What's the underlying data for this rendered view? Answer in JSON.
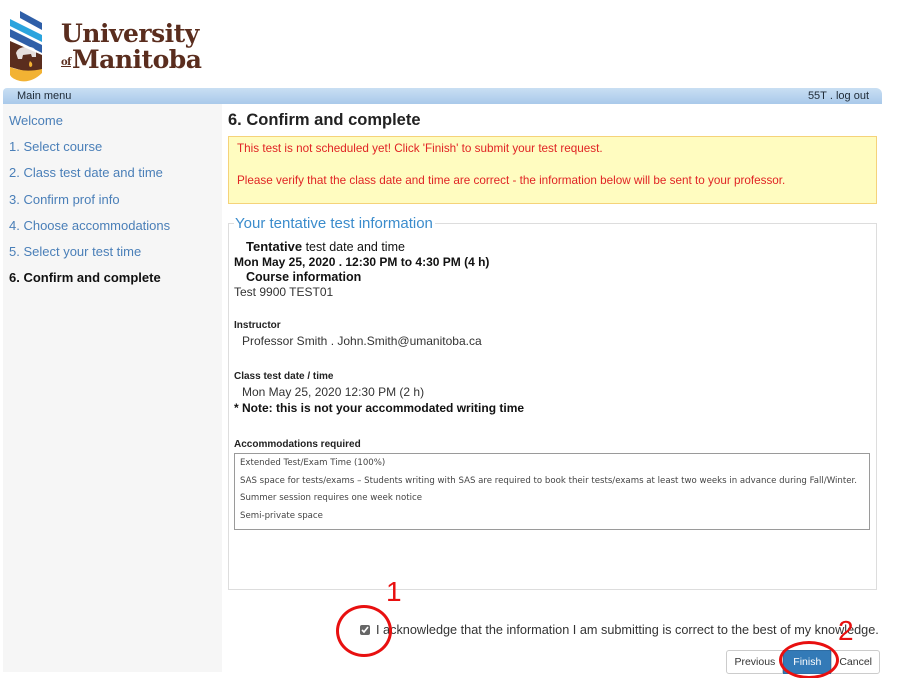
{
  "logo": {
    "line1": "University",
    "of": "of",
    "line2": "Manitoba"
  },
  "topbar": {
    "menu_label": "Main menu",
    "user_id": "55T",
    "separator": ".",
    "logout_label": "log out"
  },
  "sidebar": {
    "items": [
      {
        "label": "Welcome",
        "active": false
      },
      {
        "label": "1. Select course",
        "active": false
      },
      {
        "label": "2. Class test date and time",
        "active": false
      },
      {
        "label": "3. Confirm prof info",
        "active": false
      },
      {
        "label": "4. Choose accommodations",
        "active": false
      },
      {
        "label": "5. Select your test time",
        "active": false
      },
      {
        "label": "6. Confirm and complete",
        "active": true
      }
    ]
  },
  "main": {
    "page_title": "6. Confirm and complete",
    "alert": {
      "line1": "This test is not scheduled yet! Click 'Finish' to submit your test request.",
      "line2": "Please verify that the class date and time are correct - the information below will be sent to your professor."
    },
    "info": {
      "legend": "Your tentative test information",
      "tentative_bold": "Tentative",
      "tentative_rest": " test date and time",
      "tentative_date": "Mon May 25, 2020 . 12:30 PM to 4:30 PM (4 h)",
      "course_heading": "Course information",
      "course_value": "Test 9900 TEST01",
      "instructor_label": "Instructor",
      "instructor_value": "Professor Smith . John.Smith@umanitoba.ca",
      "class_label": "Class test date / time",
      "class_value": "Mon May 25, 2020 12:30 PM (2 h)",
      "note": "* Note: this is not your accommodated writing time",
      "accommodations_label": "Accommodations required",
      "accommodations": [
        "Extended Test/Exam Time (100%)",
        "SAS space for tests/exams – Students writing with SAS are required to book their tests/exams at least two weeks in advance during Fall/Winter.",
        "Summer session requires one week notice",
        "Semi-private space"
      ]
    }
  },
  "acknowledge": {
    "checked": true,
    "label": "I acknowledge that the information I am submitting is correct to the best of my knowledge."
  },
  "buttons": {
    "previous": "Previous",
    "finish": "Finish",
    "cancel": "Cancel"
  },
  "annotations": {
    "marker1": "1",
    "marker2": "2",
    "color": "#e81010"
  },
  "colors": {
    "link": "#4a7fb8",
    "alert_text": "#e02424",
    "alert_bg": "#fffcc0",
    "legend": "#3b8ccc",
    "finish_bg": "#337ab7"
  }
}
